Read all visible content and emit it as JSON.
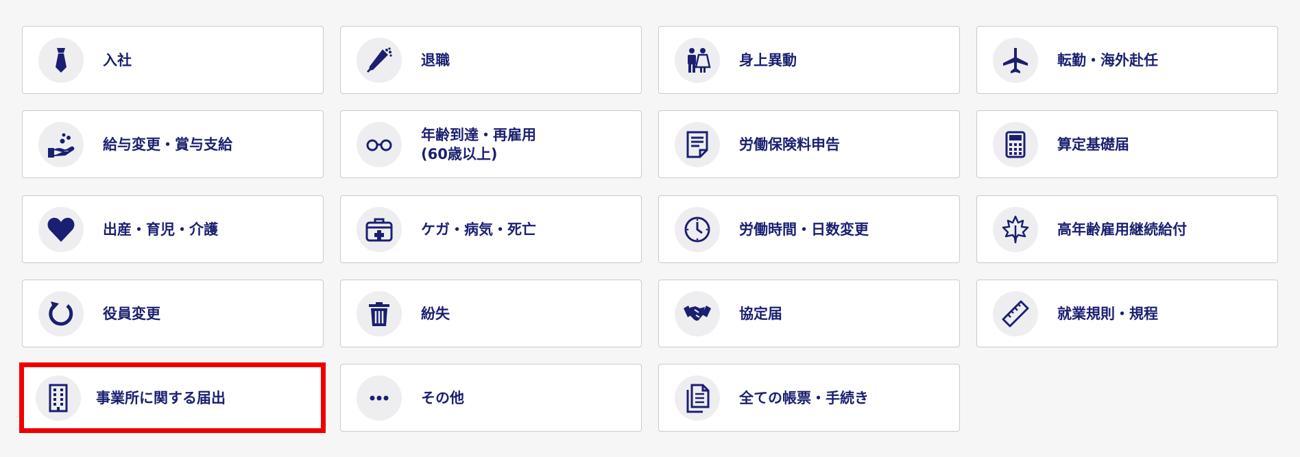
{
  "menu": {
    "items": [
      {
        "label": "入社",
        "icon": "necktie-icon"
      },
      {
        "label": "退職",
        "icon": "bouquet-icon"
      },
      {
        "label": "身上異動",
        "icon": "couple-icon"
      },
      {
        "label": "転勤・海外赴任",
        "icon": "airplane-icon"
      },
      {
        "label": "給与変更・賞与支給",
        "icon": "hand-coins-icon"
      },
      {
        "label": "年齢到達・再雇用\n(60歳以上)",
        "icon": "glasses-icon"
      },
      {
        "label": "労働保険料申告",
        "icon": "document-icon"
      },
      {
        "label": "算定基礎届",
        "icon": "calculator-icon"
      },
      {
        "label": "出産・育児・介護",
        "icon": "heart-icon"
      },
      {
        "label": "ケガ・病気・死亡",
        "icon": "first-aid-kit-icon"
      },
      {
        "label": "労働時間・日数変更",
        "icon": "clock-icon"
      },
      {
        "label": "高年齢雇用継続給付",
        "icon": "maple-leaf-icon"
      },
      {
        "label": "役員変更",
        "icon": "refresh-arrow-icon"
      },
      {
        "label": "紛失",
        "icon": "trash-can-icon"
      },
      {
        "label": "協定届",
        "icon": "handshake-icon"
      },
      {
        "label": "就業規則・規程",
        "icon": "ruler-icon"
      },
      {
        "label": "事業所に関する届出",
        "icon": "building-icon",
        "highlighted": true
      },
      {
        "label": "その他",
        "icon": "ellipsis-icon"
      },
      {
        "label": "全ての帳票・手続き",
        "icon": "documents-stack-icon"
      }
    ]
  },
  "colors": {
    "accent": "#1a1f71",
    "icon_background": "#eeeef0",
    "highlight_border": "#ee0000",
    "card_border": "#c9c9c9",
    "page_background": "#f6f6f6"
  }
}
